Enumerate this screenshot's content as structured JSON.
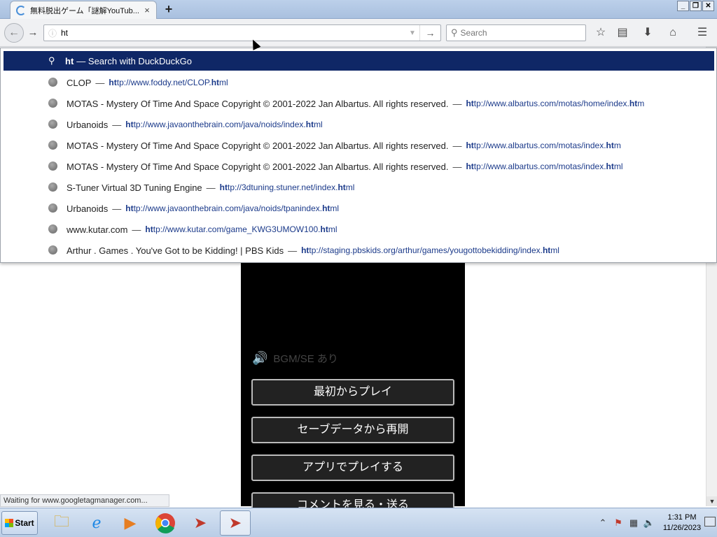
{
  "tab": {
    "title": "無料脱出ゲーム「謎解YouTub...",
    "close": "×",
    "new_tab": "+"
  },
  "window_buttons": [
    "_",
    "❐",
    "✕"
  ],
  "nav": {
    "back": "←",
    "forward": "→",
    "url_value": "ht",
    "url_go": "→",
    "search_placeholder": "Search"
  },
  "toolbar_icons": [
    "☆",
    "▤",
    "⬇",
    "⌂",
    "☰"
  ],
  "autocomplete": {
    "search_row": {
      "query": "ht",
      "suffix": "— Search with DuckDuckGo"
    },
    "rows": [
      {
        "title": "CLOP",
        "url_bold": "ht",
        "url_rest": "tp://www.foddy.net/CLOP.",
        "url_bold2": "ht",
        "url_tail": "ml"
      },
      {
        "title": "MOTAS - Mystery Of Time And Space Copyright © 2001-2022 Jan Albartus. All rights reserved.",
        "url_bold": "ht",
        "url_rest": "tp://www.albartus.com/motas/home/index.",
        "url_bold2": "ht",
        "url_tail": "m"
      },
      {
        "title": "Urbanoids",
        "url_bold": "ht",
        "url_rest": "tp://www.javaonthebrain.com/java/noids/index.",
        "url_bold2": "ht",
        "url_tail": "ml"
      },
      {
        "title": "MOTAS - Mystery Of Time And Space Copyright © 2001-2022 Jan Albartus. All rights reserved.",
        "url_bold": "ht",
        "url_rest": "tp://www.albartus.com/motas/index.",
        "url_bold2": "ht",
        "url_tail": "m"
      },
      {
        "title": "MOTAS - Mystery Of Time And Space Copyright © 2001-2022 Jan Albartus. All rights reserved.",
        "url_bold": "ht",
        "url_rest": "tp://www.albartus.com/motas/index.",
        "url_bold2": "ht",
        "url_tail": "ml"
      },
      {
        "title": "S-Tuner Virtual 3D Tuning Engine",
        "url_bold": "ht",
        "url_rest": "tp://3dtuning.stuner.net/index.",
        "url_bold2": "ht",
        "url_tail": "ml"
      },
      {
        "title": "Urbanoids",
        "url_bold": "ht",
        "url_rest": "tp://www.javaonthebrain.com/java/noids/tpanindex.",
        "url_bold2": "ht",
        "url_tail": "ml"
      },
      {
        "title": "www.kutar.com",
        "url_bold": "ht",
        "url_rest": "tp://www.kutar.com/game_KWG3UMOW100.",
        "url_bold2": "ht",
        "url_tail": "ml"
      },
      {
        "title": "Arthur . Games . You've Got to be Kidding! | PBS Kids",
        "url_bold": "ht",
        "url_rest": "tp://staging.pbskids.org/arthur/games/yougottobekidding/index.",
        "url_bold2": "ht",
        "url_tail": "ml"
      }
    ]
  },
  "game": {
    "bgm_label": "BGM/SE あり",
    "buttons": [
      "最初からプレイ",
      "セーブデータから再開",
      "アプリでプレイする",
      "コメントを見る・送る"
    ]
  },
  "status": "Waiting for www.googletagmanager.com...",
  "taskbar": {
    "start": "Start",
    "apps": [
      "folder-icon",
      "ie-icon",
      "media-player-icon",
      "chrome-icon",
      "acrobat-icon",
      "acrobat-active-icon"
    ],
    "clock_time": "1:31 PM",
    "clock_date": "11/26/2023"
  },
  "colors": {
    "autocomplete_highlight": "#0f2766",
    "url_text": "#1b3a8a",
    "game_bg": "#000000"
  }
}
